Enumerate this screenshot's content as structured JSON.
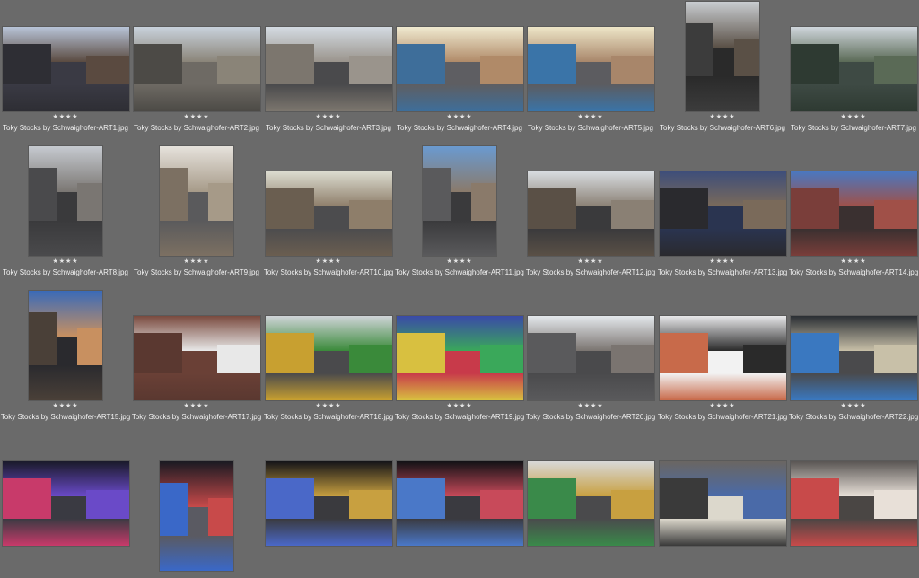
{
  "browser": {
    "items": [
      {
        "filename": "Toky Stocks by Schwaighofer-ART1.jpg",
        "rating": "★★★★",
        "orientation": "landscape",
        "palette": [
          "#b8c4d8",
          "#3a3a44",
          "#5a4a40",
          "#2e2e34"
        ]
      },
      {
        "filename": "Toky Stocks by Schwaighofer-ART2.jpg",
        "rating": "★★★★",
        "orientation": "landscape",
        "palette": [
          "#c9d2dc",
          "#6e6a64",
          "#8a8478",
          "#4c4a46"
        ]
      },
      {
        "filename": "Toky Stocks by Schwaighofer-ART3.jpg",
        "rating": "★★★★",
        "orientation": "landscape",
        "palette": [
          "#d4dbe2",
          "#4a4a4c",
          "#9a948c",
          "#7c766e"
        ]
      },
      {
        "filename": "Toky Stocks by Schwaighofer-ART4.jpg",
        "rating": "★★★★",
        "orientation": "landscape",
        "palette": [
          "#f0ead0",
          "#5e5e62",
          "#b08a68",
          "#3e6e9a"
        ]
      },
      {
        "filename": "Toky Stocks by Schwaighofer-ART5.jpg",
        "rating": "★★★★",
        "orientation": "landscape",
        "palette": [
          "#eee6c8",
          "#5c5c60",
          "#a8866a",
          "#3a74a8"
        ]
      },
      {
        "filename": "Toky Stocks by Schwaighofer-ART6.jpg",
        "rating": "★★★★",
        "orientation": "portrait",
        "palette": [
          "#c8ccd0",
          "#2a2a2a",
          "#5a5046",
          "#3c3c3c"
        ]
      },
      {
        "filename": "Toky Stocks by Schwaighofer-ART7.jpg",
        "rating": "★★★★",
        "orientation": "landscape",
        "palette": [
          "#cfd6dc",
          "#3e4a44",
          "#5a6a56",
          "#2e3a32"
        ]
      },
      {
        "filename": "Toky Stocks by Schwaighofer-ART8.jpg",
        "rating": "★★★★",
        "orientation": "portrait",
        "palette": [
          "#c6cad0",
          "#3a3a3c",
          "#7a7672",
          "#4a4a4c"
        ]
      },
      {
        "filename": "Toky Stocks by Schwaighofer-ART9.jpg",
        "rating": "★★★★",
        "orientation": "portrait",
        "palette": [
          "#e6e2dc",
          "#5a5a5c",
          "#a69a88",
          "#7c7062"
        ]
      },
      {
        "filename": "Toky Stocks by Schwaighofer-ART10.jpg",
        "rating": "★★★★",
        "orientation": "landscape",
        "palette": [
          "#dcdcd0",
          "#4c4c4e",
          "#8e7e6a",
          "#6a5e50"
        ]
      },
      {
        "filename": "Toky Stocks by Schwaighofer-ART11.jpg",
        "rating": "★★★★",
        "orientation": "portrait",
        "palette": [
          "#6a9ad0",
          "#3a3a3c",
          "#8a7a6a",
          "#5a5a5c"
        ]
      },
      {
        "filename": "Toky Stocks by Schwaighofer-ART12.jpg",
        "rating": "★★★★",
        "orientation": "landscape",
        "palette": [
          "#d8dce0",
          "#3a3a3c",
          "#8a8074",
          "#5a5046"
        ]
      },
      {
        "filename": "Toky Stocks by Schwaighofer-ART13.jpg",
        "rating": "★★★★",
        "orientation": "landscape",
        "palette": [
          "#3e4e7a",
          "#2a3450",
          "#7a6a5a",
          "#2a2a2e"
        ]
      },
      {
        "filename": "Toky Stocks by Schwaighofer-ART14.jpg",
        "rating": "★★★★",
        "orientation": "landscape",
        "palette": [
          "#4a78c0",
          "#3a3030",
          "#a05048",
          "#7a3e3a"
        ]
      },
      {
        "filename": "Toky Stocks by Schwaighofer-ART15.jpg",
        "rating": "★★★★",
        "orientation": "portrait",
        "palette": [
          "#3a6ab8",
          "#2a2a2e",
          "#c89060",
          "#4a4038"
        ]
      },
      {
        "filename": "Toky Stocks by Schwaighofer-ART17.jpg",
        "rating": "★★★★",
        "orientation": "landscape",
        "palette": [
          "#7a4a3e",
          "#6a4036",
          "#e8e8e8",
          "#5a3830"
        ]
      },
      {
        "filename": "Toky Stocks by Schwaighofer-ART18.jpg",
        "rating": "★★★★",
        "orientation": "landscape",
        "palette": [
          "#d0d4d8",
          "#4a4a4c",
          "#3a8a3a",
          "#c8a030"
        ]
      },
      {
        "filename": "Toky Stocks by Schwaighofer-ART19.jpg",
        "rating": "★★★★",
        "orientation": "landscape",
        "palette": [
          "#3a4aa8",
          "#c83a4a",
          "#3aa85a",
          "#d8c040"
        ]
      },
      {
        "filename": "Toky Stocks by Schwaighofer-ART20.jpg",
        "rating": "★★★★",
        "orientation": "landscape",
        "palette": [
          "#e4e8ec",
          "#4a4a4c",
          "#7a7470",
          "#5a5a5c"
        ]
      },
      {
        "filename": "Toky Stocks by Schwaighofer-ART21.jpg",
        "rating": "★★★★",
        "orientation": "landscape",
        "palette": [
          "#e8e8ea",
          "#f2f2f2",
          "#2a2a2a",
          "#c86a4a"
        ]
      },
      {
        "filename": "Toky Stocks by Schwaighofer-ART22.jpg",
        "rating": "★★★★",
        "orientation": "landscape",
        "palette": [
          "#2a2e34",
          "#4a4a4c",
          "#c8c0a8",
          "#3a78c0"
        ]
      },
      {
        "filename": "",
        "rating": "",
        "orientation": "landscape",
        "palette": [
          "#1a1a2a",
          "#3a3a42",
          "#6a4ac8",
          "#c83a6a"
        ]
      },
      {
        "filename": "",
        "rating": "",
        "orientation": "portrait",
        "palette": [
          "#1a1a22",
          "#5a5a62",
          "#c84a4a",
          "#3a68c8"
        ]
      },
      {
        "filename": "",
        "rating": "",
        "orientation": "landscape",
        "palette": [
          "#141418",
          "#3a3a3e",
          "#c8a040",
          "#4a68c8"
        ]
      },
      {
        "filename": "",
        "rating": "",
        "orientation": "landscape",
        "palette": [
          "#121216",
          "#3a3a40",
          "#c84a5a",
          "#4a78c8"
        ]
      },
      {
        "filename": "",
        "rating": "",
        "orientation": "landscape",
        "palette": [
          "#d8d8d8",
          "#4a4a4c",
          "#c8a040",
          "#3a8a4a"
        ]
      },
      {
        "filename": "",
        "rating": "",
        "orientation": "landscape",
        "palette": [
          "#6a6662",
          "#dcd8cc",
          "#4a6aa8",
          "#3a3a3a"
        ]
      },
      {
        "filename": "",
        "rating": "",
        "orientation": "landscape",
        "palette": [
          "#5a5654",
          "#4a4644",
          "#e8e0d8",
          "#c84a4a"
        ]
      }
    ]
  }
}
